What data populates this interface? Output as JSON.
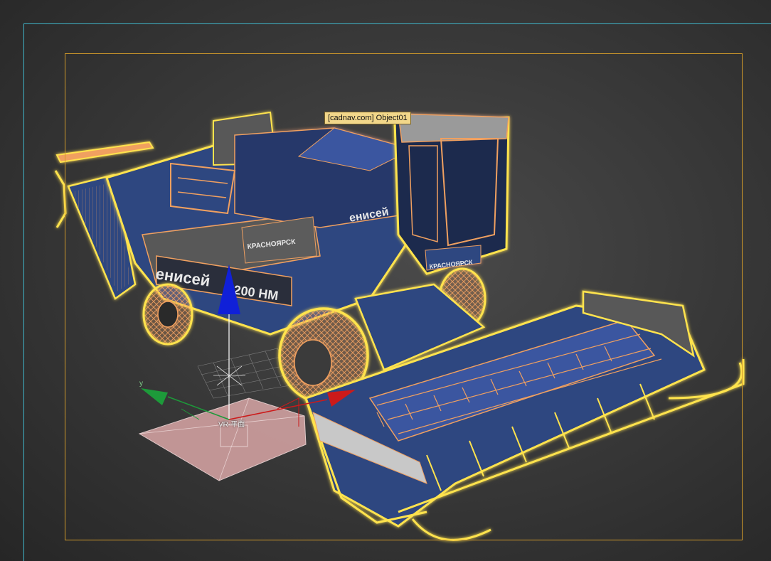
{
  "viewport": {
    "name": "3D perspective viewport",
    "selected_object_tooltip": "[cadnav.com] Object01",
    "plane_label": "VR-平面"
  },
  "scene": {
    "object_colors": {
      "body_fill": "#2f4780",
      "body_dark": "#1c2a4d",
      "wire": "#f0a060",
      "selection_glow": "#ffe34d",
      "grey_panel": "#595959"
    },
    "decal_texts": [
      "енисей",
      "1200 HM",
      "КРАСНОЯРСК",
      "енисей",
      "КРАСНОЯРСК"
    ],
    "gizmo": {
      "x_axis_color": "#cc1a1a",
      "y_axis_color": "#1d9a3a",
      "z_axis_color": "#1020d8",
      "x_axis_label": "",
      "y_axis_label": "y",
      "z_axis_label": ""
    },
    "plane_color": "#c99b9b"
  },
  "frame_colors": {
    "viewport_border": "#3fb3c6",
    "safe_frame": "#d19a2a"
  }
}
